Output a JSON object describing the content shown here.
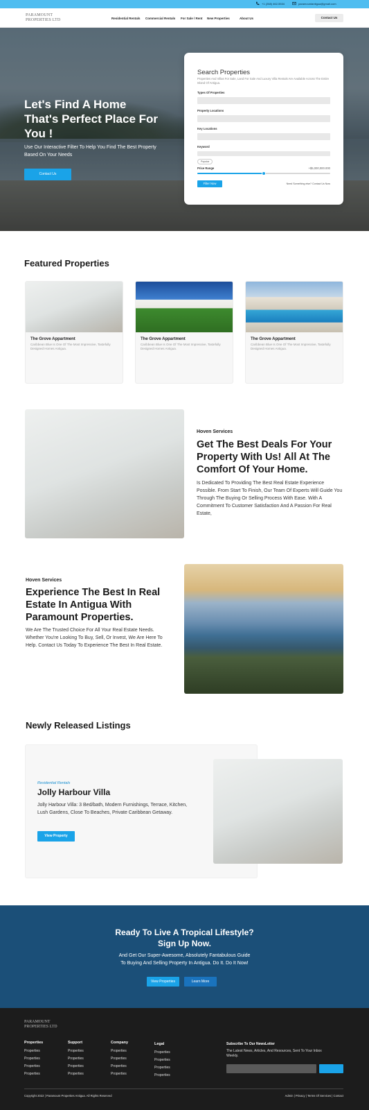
{
  "topbar": {
    "phone": "+1 (268) 462-5534",
    "email": "paramountantigua@gmail.com"
  },
  "nav": {
    "logo_line1": "PARAMOUNT",
    "logo_line2": "PROPERTIES LTD",
    "links": [
      "Residential Rentals",
      "Commercial Rentals",
      "For Sale / Rent",
      "New Properties",
      "About Us"
    ],
    "contact": "Contact Us"
  },
  "hero": {
    "title": "Let's Find A Home That's Perfect Place For You !",
    "subtitle": "Use Our Interactive Filter To Help You Find The Best Property Based On Your Needs",
    "button": "Contact Us"
  },
  "search": {
    "title": "Search Properties",
    "description": "Properties And Villas For Sale, Land For Sale And Luxury Villa Rentals Are Available Across The Entire Island Of Antigua.",
    "types_label": "Types Of Properties",
    "locations_label": "Property Locations",
    "key_locations_label": "Key Locations",
    "keyword_label": "Keyword",
    "chip": "Popular",
    "price_label": "Price Range",
    "price_value": "+$5,000,000.000",
    "price_fraction": 0.5,
    "filter_button": "Filter Now",
    "help_link": "Need Something else? Contact Us Now"
  },
  "featured": {
    "heading": "Featured Properties",
    "cards": [
      {
        "title": "The Grove Appartment",
        "desc": "Caribbean Blue Is One Of The Most Impressive, Tastefully Designed Homes Antigua.",
        "image": "interior-desk"
      },
      {
        "title": "The Grove Appartment",
        "desc": "Caribbean Blue Is One Of The Most Impressive, Tastefully Designed Homes Antigua.",
        "image": "villa-garden"
      },
      {
        "title": "The Grove Appartment",
        "desc": "Caribbean Blue Is One Of The Most Impressive, Tastefully Designed Homes Antigua.",
        "image": "villa-pool"
      }
    ]
  },
  "deals": {
    "eyebrow": "Hoven Services",
    "title": "Get The Best Deals For Your Property With Us! All At The Comfort Of Your Home.",
    "body": "Is Dedicated To Providing The Best Real Estate Experience Possible. From Start To Finish, Our Team Of Experts Will Guide You Through The Buying Or Selling Process With Ease. With A Commitment To Customer Satisfaction And A Passion For Real Estate,"
  },
  "experience": {
    "eyebrow": "Hoven Services",
    "title": "Experience The Best In Real Estate In Antigua With Paramount Properties.",
    "body": "We Are The Trusted Choice For All Your Real Estate Needs. Whether You're Looking To Buy, Sell, Or Invest, We Are Here To Help. Contact Us Today To Experience The Best In Real Estate."
  },
  "listings": {
    "heading": "Newly Released Listings",
    "category": "Residential Rentals",
    "title": "Jolly Harbour Villa",
    "desc": "Jolly Harbour Villa: 3 Bed/bath, Modern Furnishings, Terrace, Kitchen, Lush Gardens, Close To Beaches, Private Caribbean Getaway.",
    "button": "View Property"
  },
  "cta": {
    "title_line1": "Ready To Live A Tropical Lifestyle?",
    "title_line2": "Sign Up Now.",
    "sub_line1": "And Get Our Super-Awesome, Absolutely Fantabulous Guide",
    "sub_line2": "To Buying And Selling Property In Antigua. Do It. Do It Now!",
    "button1": "View Properties",
    "button2": "Learn More"
  },
  "footer": {
    "logo_line1": "PARAMOUNT",
    "logo_line2": "PROPERTIES LTD",
    "columns": [
      {
        "heading": "Properties",
        "links": [
          "Properties",
          "Properties",
          "Properties",
          "Properties"
        ]
      },
      {
        "heading": "Support",
        "links": [
          "Properties",
          "Properties",
          "Properties",
          "Properties"
        ]
      },
      {
        "heading": "Company",
        "links": [
          "Properties",
          "Properties",
          "Properties",
          "Properties"
        ]
      },
      {
        "heading": "Legal",
        "links": [
          "Properties",
          "Properties",
          "Properties",
          "Properties"
        ]
      }
    ],
    "newsletter_heading": "Subscribe To Our NewsLetter",
    "newsletter_desc": "The Latest News, Articles, And Resources, Sent To Your Inbox Weekly.",
    "copyright": "Copyright 2022 | Paramount Properties Antigua. All Rights Reserved",
    "legal": "Admin | Privacy | Terms Of Services | Contact"
  },
  "colors": {
    "accent": "#1aa3e8",
    "topbar": "#4fbdf0",
    "cta_bg": "#1b4f78",
    "footer_bg": "#1c1c1c"
  }
}
